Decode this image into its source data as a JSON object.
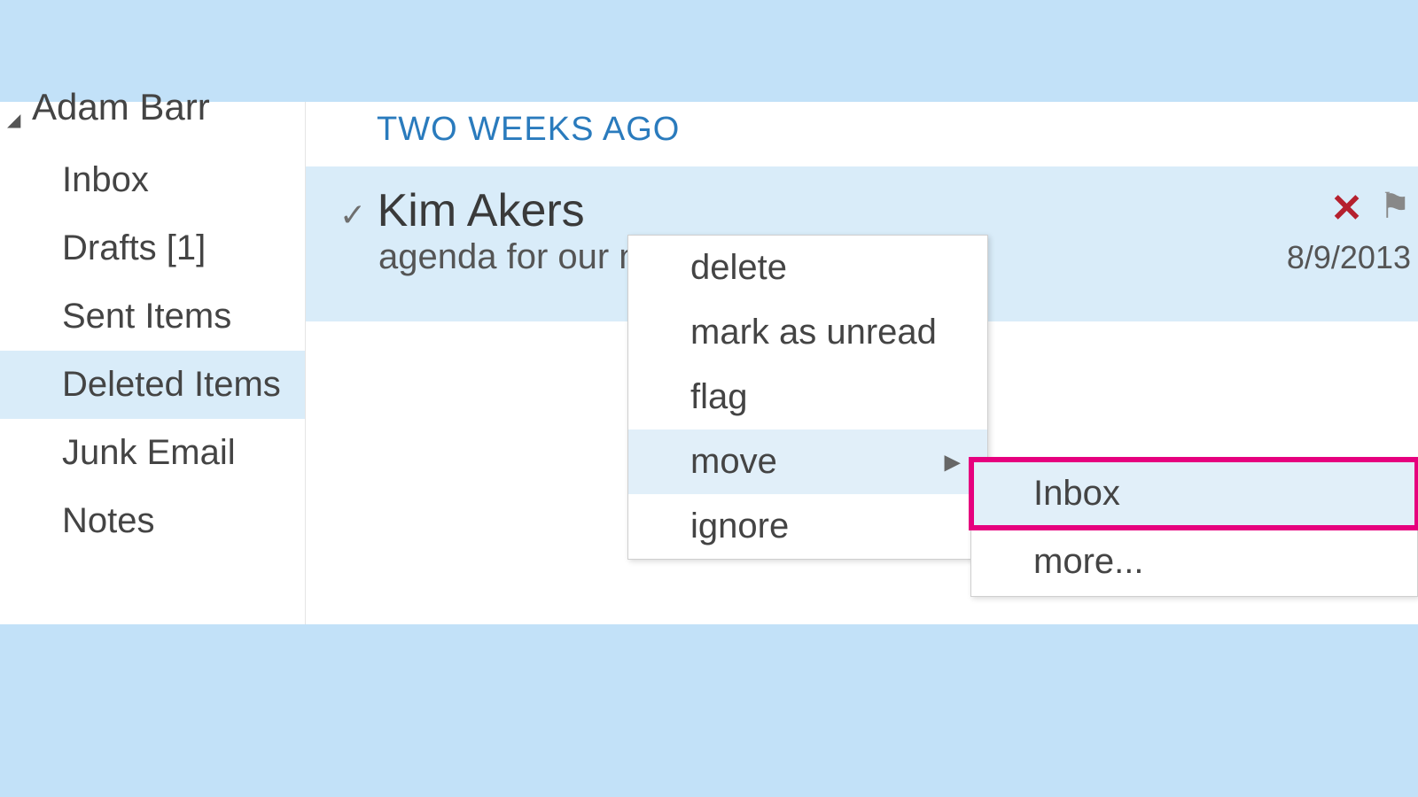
{
  "sidebar": {
    "account_name": "Adam Barr",
    "folders": [
      {
        "label": "Inbox",
        "selected": false
      },
      {
        "label": "Drafts [1]",
        "selected": false
      },
      {
        "label": "Sent Items",
        "selected": false
      },
      {
        "label": "Deleted Items",
        "selected": true
      },
      {
        "label": "Junk Email",
        "selected": false
      },
      {
        "label": "Notes",
        "selected": false
      }
    ]
  },
  "message_list": {
    "group_header": "TWO WEEKS AGO",
    "message": {
      "sender": "Kim Akers",
      "subject": "agenda for our n",
      "date": "8/9/2013"
    }
  },
  "context_menu": {
    "items": [
      {
        "label": "delete",
        "has_submenu": false,
        "hover": false
      },
      {
        "label": "mark as unread",
        "has_submenu": false,
        "hover": false
      },
      {
        "label": "flag",
        "has_submenu": false,
        "hover": false
      },
      {
        "label": "move",
        "has_submenu": true,
        "hover": true
      },
      {
        "label": "ignore",
        "has_submenu": false,
        "hover": false
      }
    ]
  },
  "submenu": {
    "items": [
      {
        "label": "Inbox",
        "highlighted": true
      },
      {
        "label": "more...",
        "highlighted": false
      }
    ]
  }
}
